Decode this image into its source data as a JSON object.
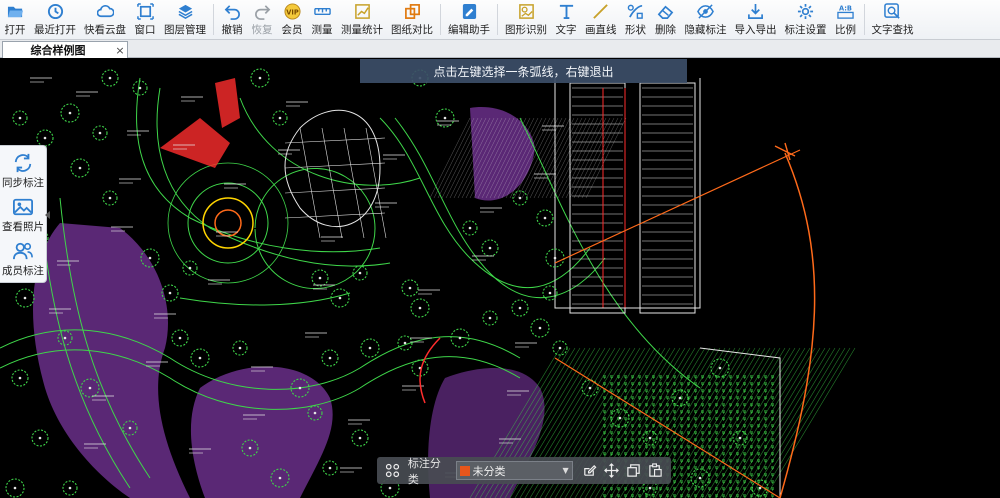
{
  "toolbar": {
    "items": [
      {
        "id": "open",
        "label": "打开",
        "icon": "folder-open-icon",
        "color": "#2f7fd0"
      },
      {
        "id": "recent",
        "label": "最近打开",
        "icon": "history-icon",
        "color": "#2f7fd0"
      },
      {
        "id": "cloud",
        "label": "快看云盘",
        "icon": "cloud-icon",
        "color": "#2f7fd0"
      },
      {
        "id": "window",
        "label": "窗口",
        "icon": "window-icon",
        "color": "#2f7fd0"
      },
      {
        "id": "layers",
        "label": "图层管理",
        "icon": "layers-icon",
        "color": "#2f7fd0"
      },
      {
        "id": "undo",
        "label": "撤销",
        "icon": "undo-icon",
        "color": "#2f7fd0"
      },
      {
        "id": "redo",
        "label": "恢复",
        "icon": "redo-icon",
        "color": "#9aa0a6",
        "disabled": true
      },
      {
        "id": "vip",
        "label": "会员",
        "icon": "vip-icon",
        "color": "#d6a21c",
        "vip": true
      },
      {
        "id": "measure",
        "label": "测量",
        "icon": "ruler-icon",
        "color": "#2f7fd0"
      },
      {
        "id": "measure_stats",
        "label": "测量统计",
        "icon": "measure-stats-icon",
        "color": "#c8a22a"
      },
      {
        "id": "compare",
        "label": "图纸对比",
        "icon": "compare-icon",
        "color": "#e07a10"
      },
      {
        "id": "editor",
        "label": "编辑助手",
        "icon": "edit-assistant-icon",
        "color": "#2f7fd0"
      },
      {
        "id": "shape_recog",
        "label": "图形识别",
        "icon": "shape-recognition-icon",
        "color": "#c8a22a"
      },
      {
        "id": "text",
        "label": "文字",
        "icon": "text-icon",
        "color": "#2f7fd0"
      },
      {
        "id": "line",
        "label": "画直线",
        "icon": "line-icon",
        "color": "#c8a22a"
      },
      {
        "id": "shape",
        "label": "形状",
        "icon": "shape-icon",
        "color": "#2f7fd0"
      },
      {
        "id": "delete",
        "label": "删除",
        "icon": "eraser-icon",
        "color": "#2f7fd0"
      },
      {
        "id": "hide",
        "label": "隐藏标注",
        "icon": "eye-hidden-icon",
        "color": "#2f7fd0"
      },
      {
        "id": "import_export",
        "label": "导入导出",
        "icon": "import-export-icon",
        "color": "#2f7fd0"
      },
      {
        "id": "mark_settings",
        "label": "标注设置",
        "icon": "settings-icon",
        "color": "#2f7fd0"
      },
      {
        "id": "ratio",
        "label": "比例",
        "icon": "ratio-icon",
        "color": "#2f7fd0"
      },
      {
        "id": "text_search",
        "label": "文字查找",
        "icon": "text-search-icon",
        "color": "#2f7fd0"
      }
    ],
    "vip_badge": "VIP",
    "ratio_badge": "A:B",
    "separators_after": [
      "layers",
      "compare",
      "editor",
      "ratio"
    ]
  },
  "tab": {
    "title": "综合样例图",
    "close_glyph": "×"
  },
  "hint": {
    "text": "点击左键选择一条弧线，右键退出"
  },
  "sidepanel": {
    "items": [
      {
        "id": "sync",
        "label": "同步标注",
        "icon": "sync-icon"
      },
      {
        "id": "photos",
        "label": "查看照片",
        "icon": "photo-icon"
      },
      {
        "id": "members",
        "label": "成员标注",
        "icon": "members-icon"
      }
    ]
  },
  "bottombar": {
    "category_label": "标注分类",
    "category_value": "未分类",
    "category_color": "#e8561b"
  },
  "colors": {
    "accent": "#2f7fd0",
    "canvas_bg": "#000000",
    "cad_green": "#3fd64a",
    "cad_white": "#e6e6e6",
    "cad_purple": "#6a2f8a",
    "cad_yellow": "#ffd400",
    "cad_red": "#ff2d2d",
    "cad_orange": "#ff6a1a"
  }
}
